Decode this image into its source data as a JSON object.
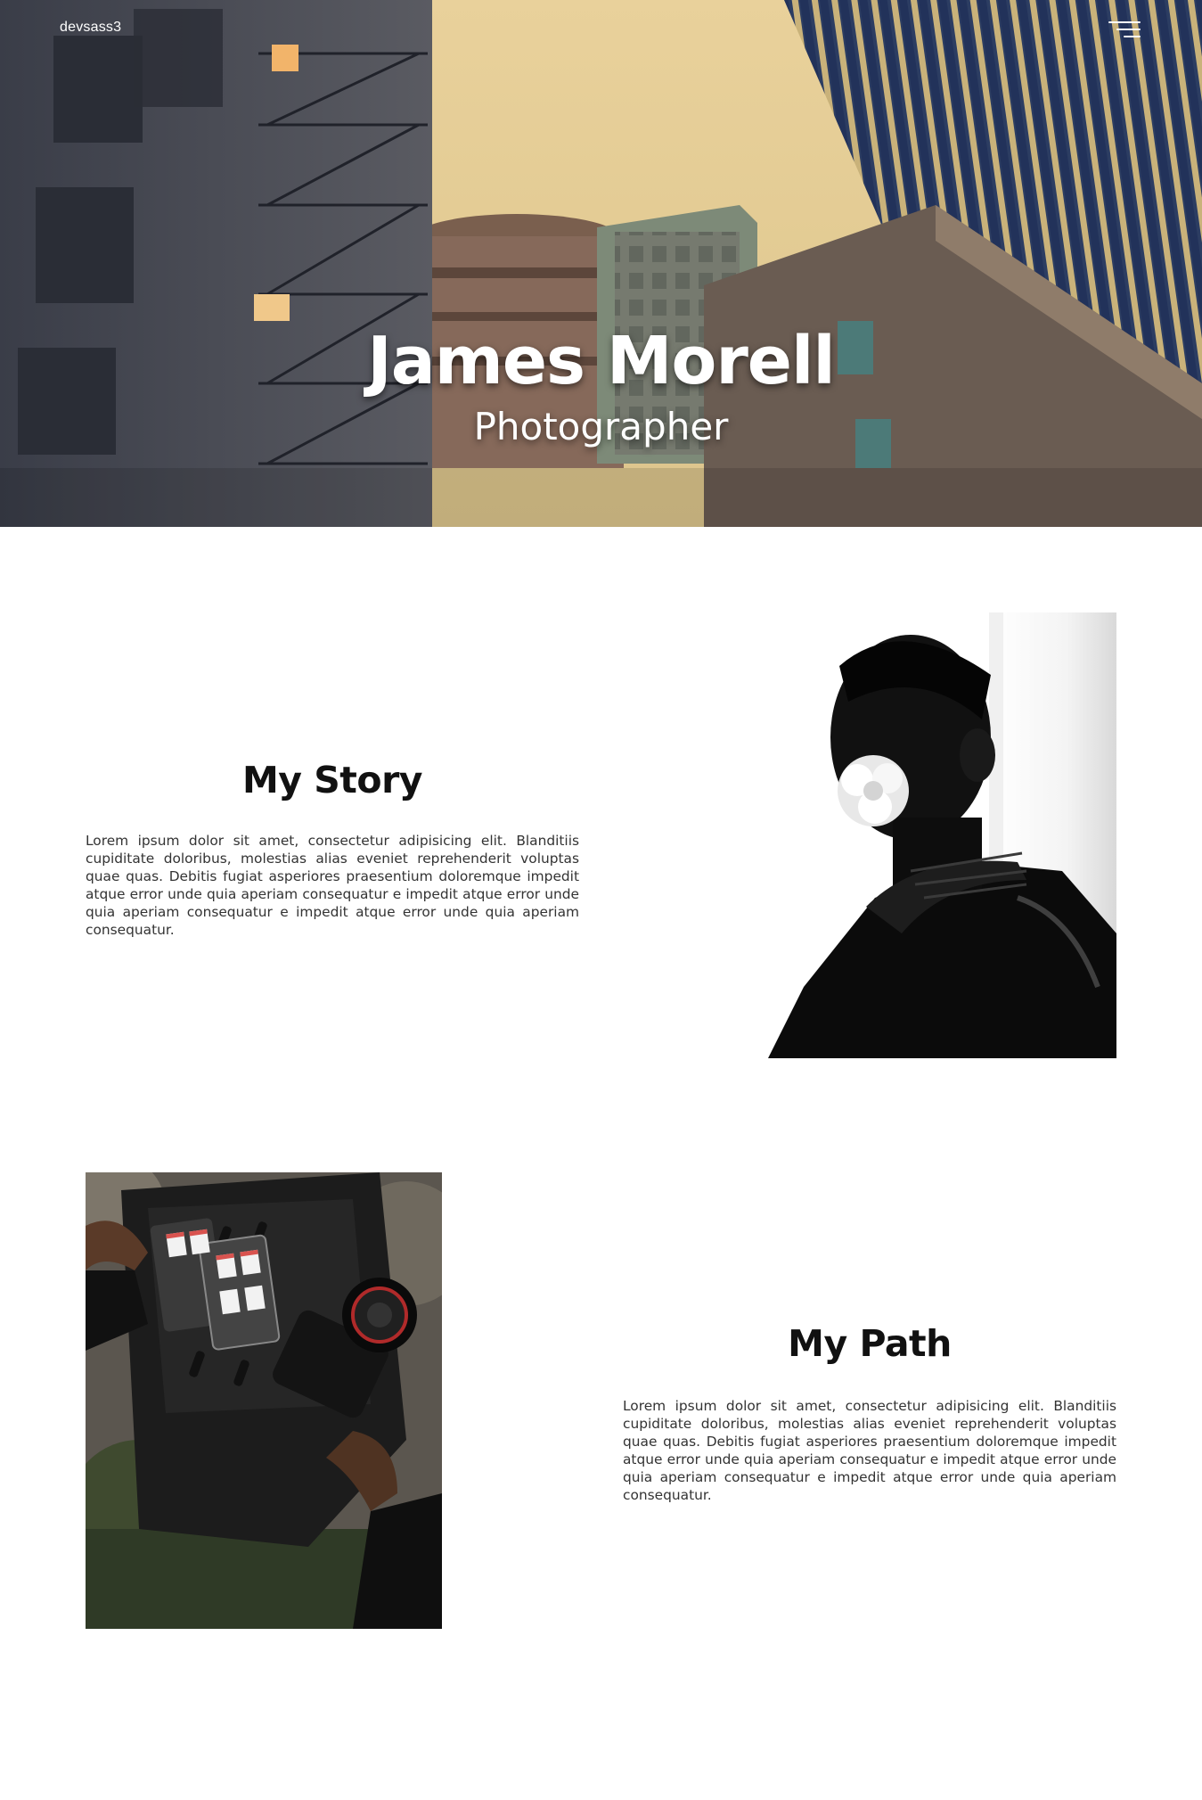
{
  "header": {
    "brand": "devsass3",
    "menu_icon": "hamburger-menu-icon"
  },
  "hero": {
    "title": "James Morell",
    "subtitle": "Photographer",
    "image": "city-buildings-looking-up-photo"
  },
  "sections": [
    {
      "title": "My Story",
      "text": "Lorem ipsum dolor sit amet, consectetur adipisicing elit. Blanditiis cupiditate doloribus, molestias alias eveniet reprehenderit voluptas quae quas. Debitis fugiat asperiores praesentium doloremque impedit atque error unde quia aperiam consequatur e impedit atque error unde quia aperiam consequatur e impedit atque error unde quia aperiam consequatur.",
      "image": "portrait-man-with-flower-photo"
    },
    {
      "title": "My Path",
      "text": "Lorem ipsum dolor sit amet, consectetur adipisicing elit. Blanditiis cupiditate doloribus, molestias alias eveniet reprehenderit voluptas quae quas. Debitis fugiat asperiores praesentium doloremque impedit atque error unde quia aperiam consequatur e impedit atque error unde quia aperiam consequatur e impedit atque error unde quia aperiam consequatur.",
      "image": "camera-gear-backpack-photo"
    }
  ],
  "colors": {
    "hero_sky": "#e7cf97",
    "text_dark": "#111111",
    "body_text": "#333333",
    "background": "#ffffff"
  }
}
